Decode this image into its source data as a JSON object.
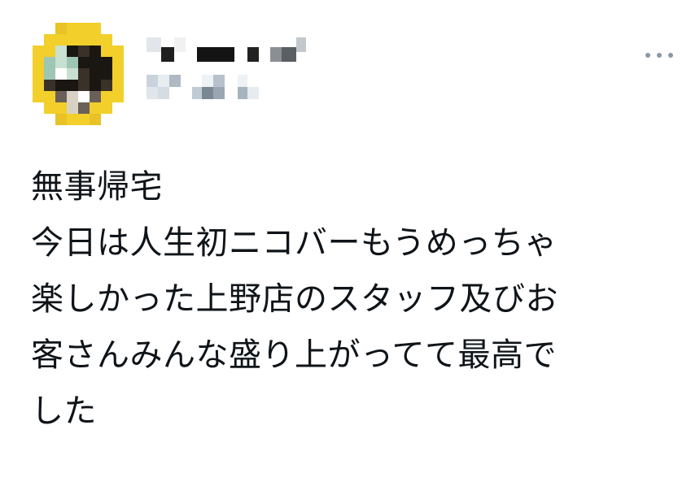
{
  "author": {
    "display_name": "",
    "handle": ""
  },
  "actions": {
    "more_icon": "more-horizontal-icon"
  },
  "tweet": {
    "lines": [
      "無事帰宅",
      "今日は人生初ニコバーもうめっちゃ",
      "楽しかった上野店のスタッフ及びお",
      "客さんみんな盛り上がってて最高で",
      "した"
    ]
  },
  "colors": {
    "text": "#0f1419",
    "icon_gray": "#8b98a5",
    "avatar_yellow": "#f2cf2a"
  }
}
